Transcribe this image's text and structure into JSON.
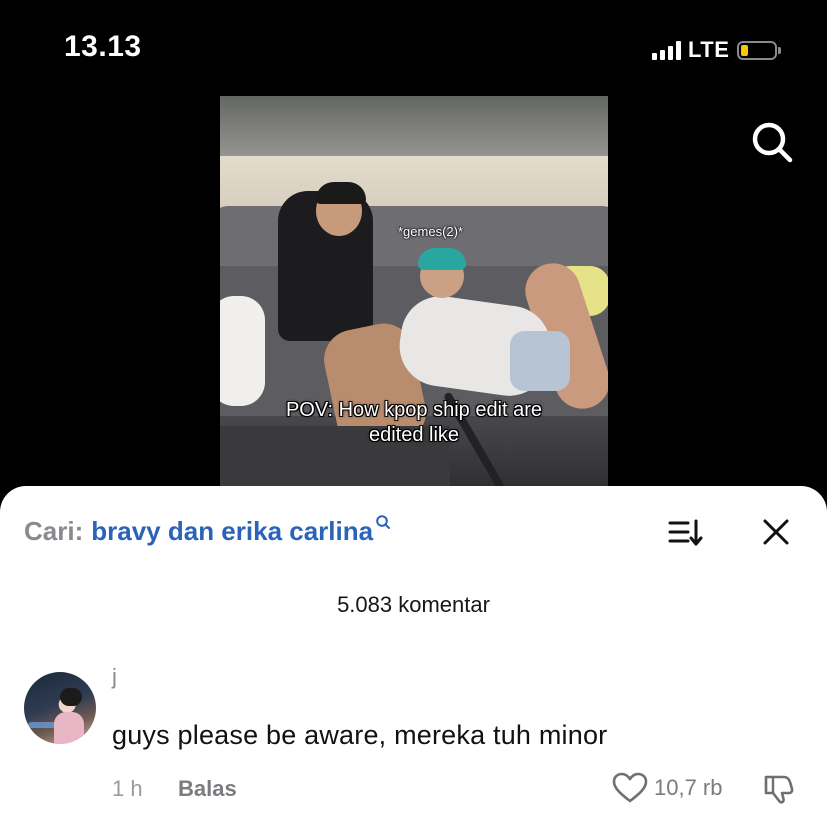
{
  "status_bar": {
    "time": "13.13",
    "network": "LTE",
    "battery_color": "#f5c800"
  },
  "video": {
    "overlay_small": "*gemes(2)*",
    "caption_line1": "POV: How kpop ship edit are",
    "caption_line2": "edited like"
  },
  "comments_sheet": {
    "search_prefix": "Cari:",
    "search_query": "bravy dan erika carlina",
    "count_label": "5.083 komentar",
    "icons": [
      "search-icon",
      "sort-icon",
      "close-icon"
    ],
    "accent_color": "#2b63b8"
  },
  "comment": {
    "username": "j",
    "text": "guys please be aware, mereka tuh minor",
    "time": "1 h",
    "reply_label": "Balas",
    "like_count": "10,7 rb",
    "icons": [
      "heart-icon",
      "dislike-icon"
    ]
  }
}
